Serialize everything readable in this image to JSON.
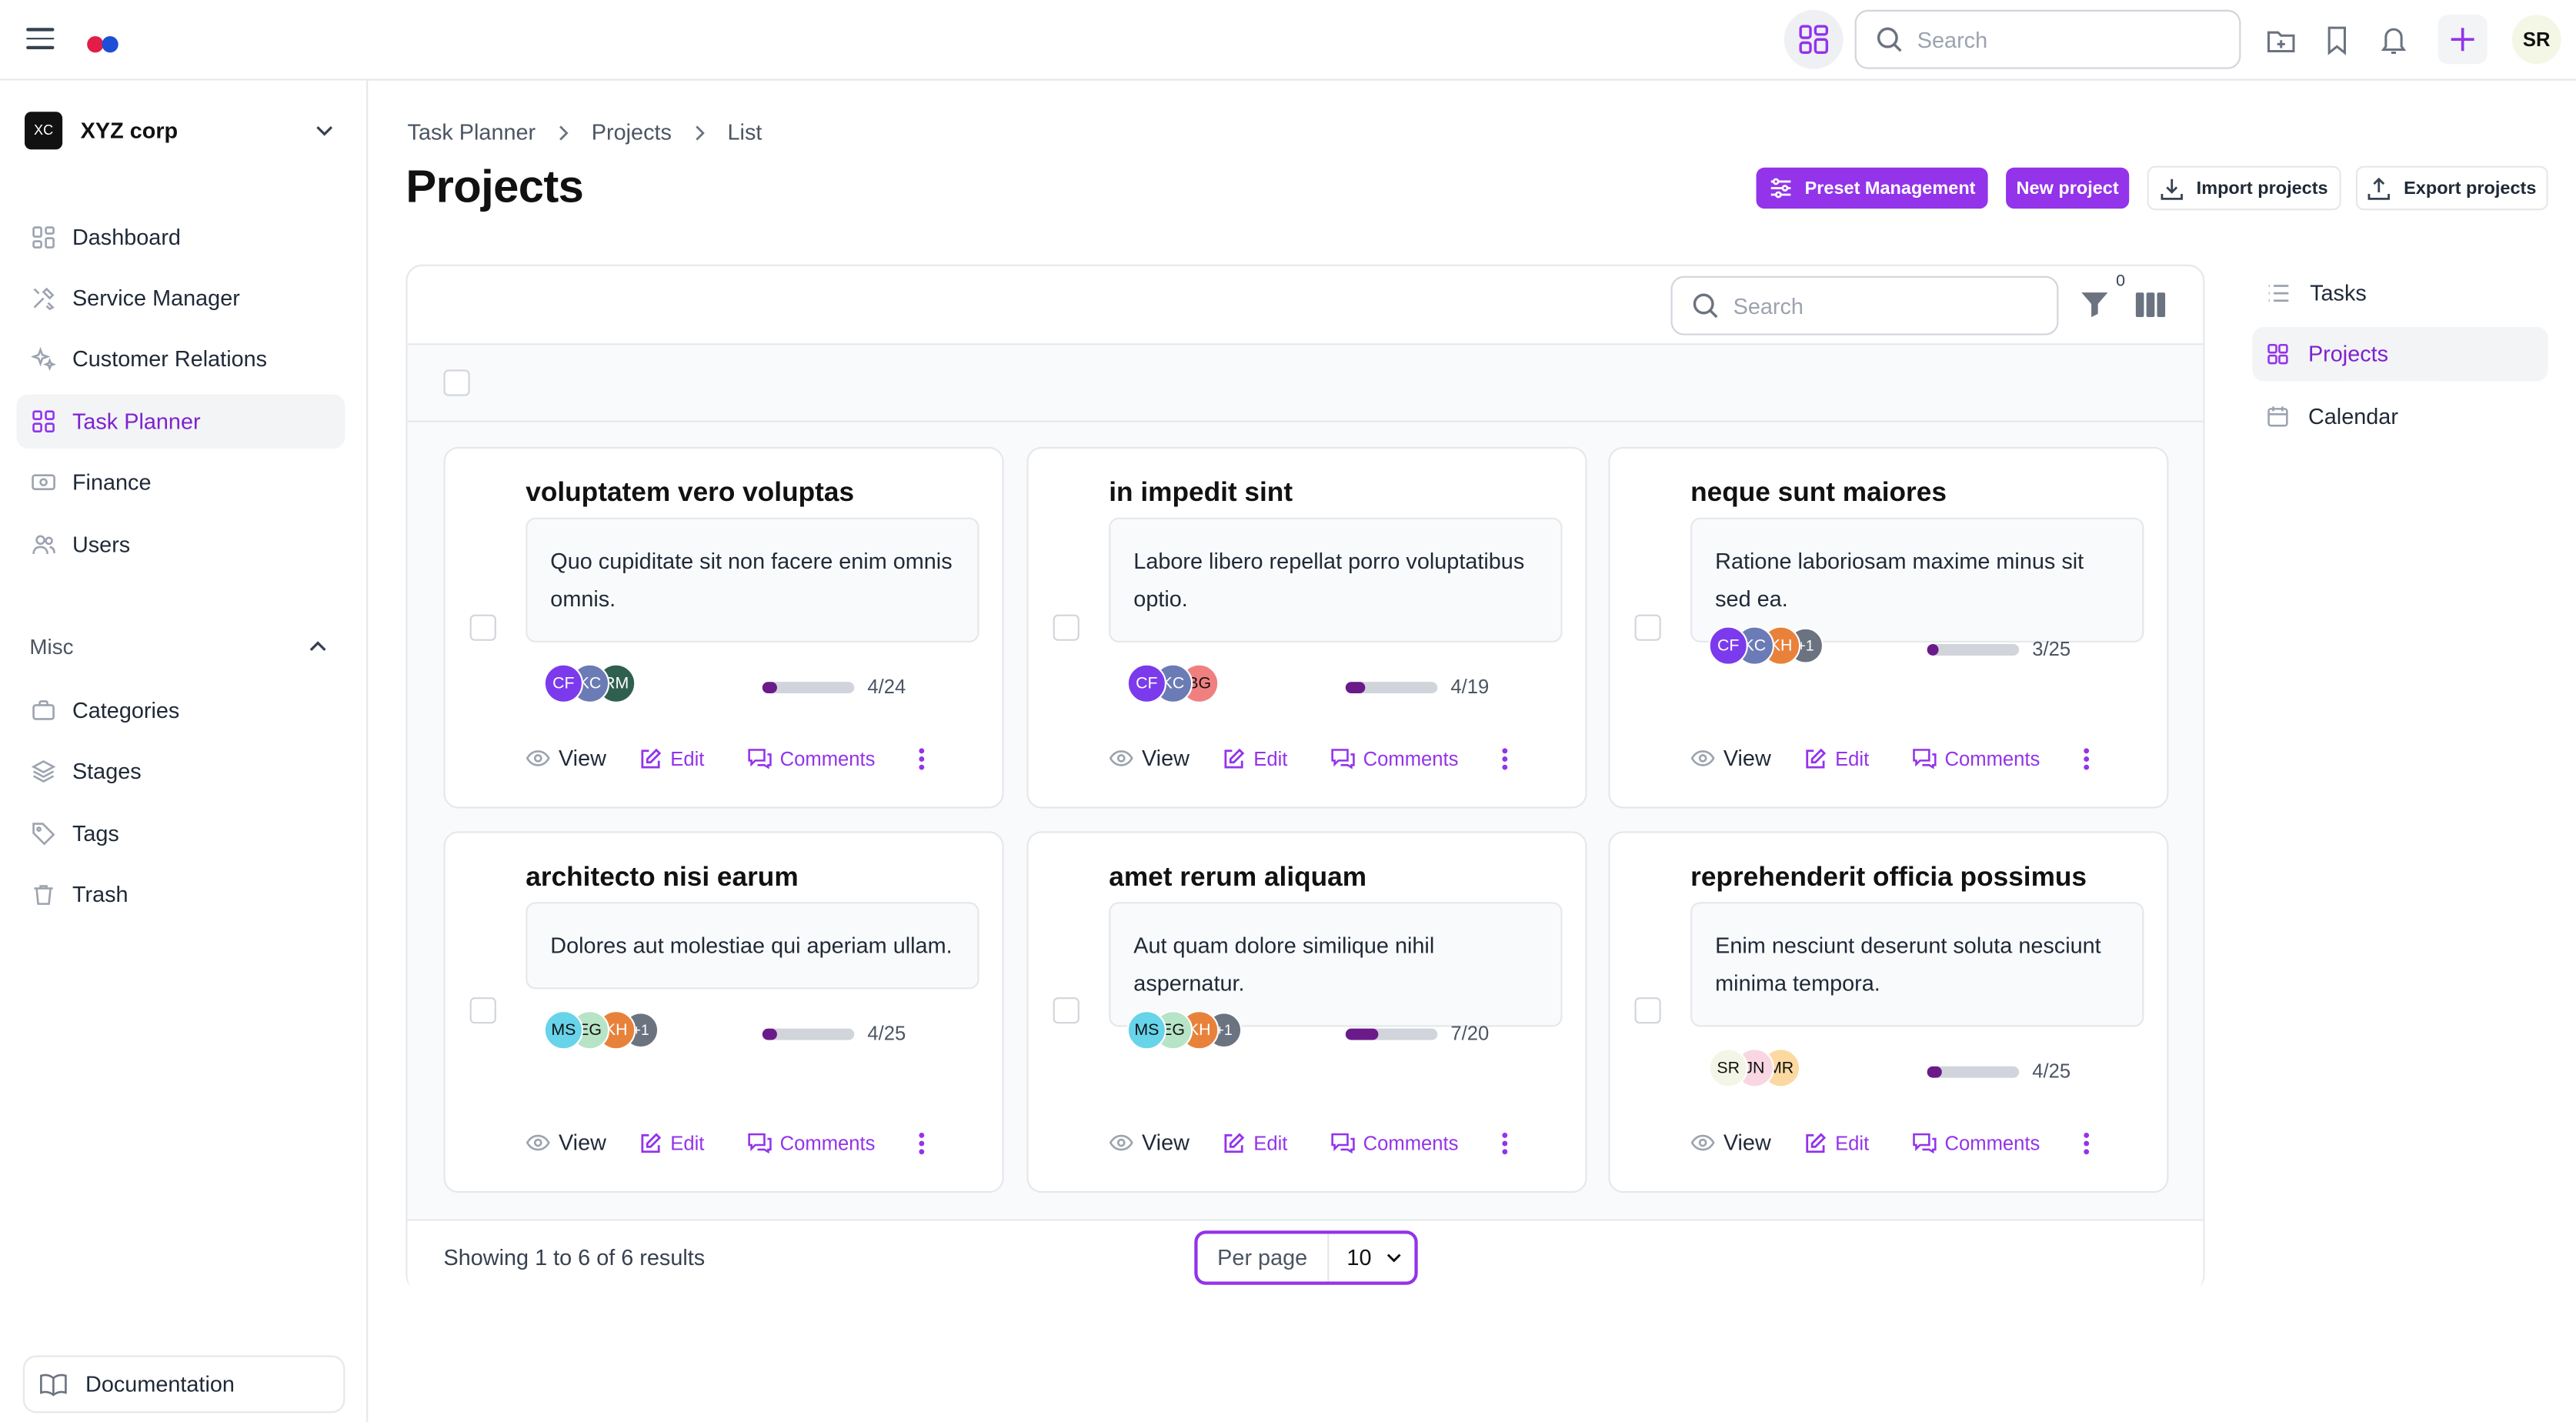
{
  "topbar": {
    "search_placeholder": "Search",
    "user_initials": "SR",
    "logo_colors": [
      "#e11d48",
      "#1d4ed8"
    ]
  },
  "org": {
    "badge": "XC",
    "name": "XYZ corp"
  },
  "sidebar": {
    "items": [
      {
        "label": "Dashboard",
        "icon": "dashboard-icon"
      },
      {
        "label": "Service Manager",
        "icon": "tools-icon"
      },
      {
        "label": "Customer Relations",
        "icon": "sparkles-icon"
      },
      {
        "label": "Task Planner",
        "icon": "grid-icon",
        "active": true
      },
      {
        "label": "Finance",
        "icon": "banknote-icon"
      },
      {
        "label": "Users",
        "icon": "users-icon"
      }
    ],
    "misc_label": "Misc",
    "misc_items": [
      {
        "label": "Categories",
        "icon": "briefcase-icon"
      },
      {
        "label": "Stages",
        "icon": "layers-icon"
      },
      {
        "label": "Tags",
        "icon": "tag-icon"
      },
      {
        "label": "Trash",
        "icon": "trash-icon"
      }
    ],
    "documentation": "Documentation"
  },
  "breadcrumb": [
    "Task Planner",
    "Projects",
    "List"
  ],
  "page_title": "Projects",
  "header_buttons": {
    "preset": "Preset Management",
    "new_project": "New project",
    "import": "Import projects",
    "export": "Export projects"
  },
  "panel": {
    "search_placeholder": "Search",
    "filter_count": "0"
  },
  "cards": [
    {
      "title": "voluptatem vero voluptas",
      "description": "Quo cupiditate sit non facere enim omnis omnis.",
      "avatars": [
        {
          "initials": "CF",
          "color": "#7c3aed"
        },
        {
          "initials": "KC",
          "color": "#6b7bb5"
        },
        {
          "initials": "RM",
          "color": "#2f5f4f"
        }
      ],
      "progress": "4/24",
      "progress_value": 0.167,
      "actions": {
        "view": "View",
        "edit": "Edit",
        "comments": "Comments"
      }
    },
    {
      "title": "in impedit sint",
      "description": "Labore libero repellat porro voluptatibus optio.",
      "avatars": [
        {
          "initials": "CF",
          "color": "#7c3aed"
        },
        {
          "initials": "KC",
          "color": "#6b7bb5"
        },
        {
          "initials": "BG",
          "color": "#f08080"
        }
      ],
      "progress": "4/19",
      "progress_value": 0.21,
      "actions": {
        "view": "View",
        "edit": "Edit",
        "comments": "Comments"
      }
    },
    {
      "title": "neque sunt maiores",
      "description": "Ratione laboriosam maxime minus sit sed ea.",
      "avatars": [
        {
          "initials": "CF",
          "color": "#7c3aed"
        },
        {
          "initials": "KC",
          "color": "#6b7bb5"
        },
        {
          "initials": "KH",
          "color": "#e8823a"
        },
        {
          "initials": "+1",
          "color": "#6b7280"
        }
      ],
      "progress": "3/25",
      "progress_value": 0.12,
      "actions": {
        "view": "View",
        "edit": "Edit",
        "comments": "Comments"
      }
    },
    {
      "title": "architecto nisi earum",
      "description": "Dolores aut molestiae qui aperiam ullam.",
      "avatars": [
        {
          "initials": "MS",
          "color": "#67d4ea"
        },
        {
          "initials": "EG",
          "color": "#b7e4c7"
        },
        {
          "initials": "KH",
          "color": "#e8823a"
        },
        {
          "initials": "+1",
          "color": "#6b7280"
        }
      ],
      "progress": "4/25",
      "progress_value": 0.16,
      "actions": {
        "view": "View",
        "edit": "Edit",
        "comments": "Comments"
      }
    },
    {
      "title": "amet rerum aliquam",
      "description": "Aut quam dolore similique nihil aspernatur.",
      "avatars": [
        {
          "initials": "MS",
          "color": "#67d4ea"
        },
        {
          "initials": "EG",
          "color": "#b7e4c7"
        },
        {
          "initials": "KH",
          "color": "#e8823a"
        },
        {
          "initials": "+1",
          "color": "#6b7280"
        }
      ],
      "progress": "7/20",
      "progress_value": 0.35,
      "actions": {
        "view": "View",
        "edit": "Edit",
        "comments": "Comments"
      }
    },
    {
      "title": "reprehenderit officia possimus",
      "description": "Enim nesciunt deserunt soluta nesciunt minima tempora.",
      "avatars": [
        {
          "initials": "SR",
          "color": "#f3f6e6"
        },
        {
          "initials": "JN",
          "color": "#f8d7e3"
        },
        {
          "initials": "MR",
          "color": "#fcd9a0"
        }
      ],
      "progress": "4/25",
      "progress_value": 0.16,
      "actions": {
        "view": "View",
        "edit": "Edit",
        "comments": "Comments"
      }
    }
  ],
  "footer": {
    "results": "Showing 1 to 6 of 6 results",
    "per_page_label": "Per page",
    "per_page_value": "10"
  },
  "subnav": [
    {
      "label": "Tasks",
      "icon": "list-icon"
    },
    {
      "label": "Projects",
      "icon": "grid-icon",
      "active": true
    },
    {
      "label": "Calendar",
      "icon": "calendar-icon"
    }
  ],
  "colors": {
    "accent": "#9333ea",
    "progress_fill": "#6b1a8a"
  }
}
